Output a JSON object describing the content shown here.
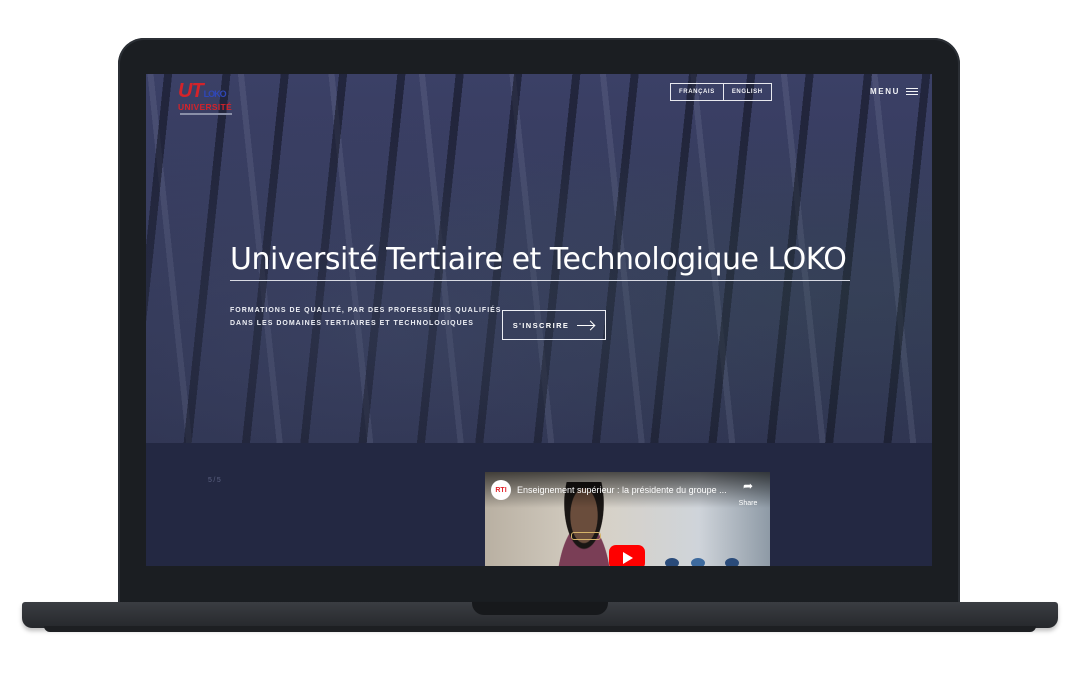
{
  "header": {
    "logo": {
      "mark": "UT",
      "mark_suffix": "LOKO",
      "word": "UNIVERSITÉ",
      "icon": "university-logo-icon"
    },
    "languages": [
      "FRANÇAIS",
      "ENGLISH"
    ],
    "menu_label": "MENU",
    "menu_icon": "hamburger-icon"
  },
  "hero": {
    "title": "Université Tertiaire et Technologique LOKO",
    "tagline": "FORMATIONS DE QUALITÉ, PAR DES PROFESSEURS QUALIFIÉS DANS LES DOMAINES TERTIAIRES ET TECHNOLOGIQUES",
    "cta_label": "S'INSCRIRE",
    "cta_icon": "arrow-right-icon"
  },
  "lower": {
    "slide_counter": "5/5"
  },
  "video": {
    "channel": "RTI",
    "title": "Enseignement supérieur : la présidente du groupe ...",
    "share_label": "Share",
    "share_icon": "share-arrow-icon",
    "play_icon": "youtube-play-icon"
  },
  "colors": {
    "hero_overlay": "#353a5c",
    "section_bg": "#232842",
    "logo_red": "#d4232a",
    "logo_blue": "#2f47b8",
    "play_red": "#ff0000"
  }
}
